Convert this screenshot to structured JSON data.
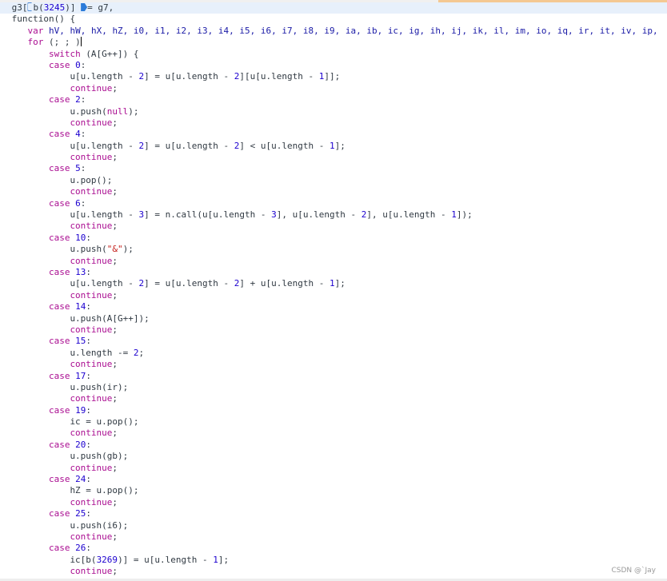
{
  "colors": {
    "keyword": "#aa0d91",
    "number": "#1c00cf",
    "string": "#c41a16",
    "variable": "#1a1aa6",
    "text": "#303942",
    "highlight": "#e7f0fb"
  },
  "icons": [
    "breakpoint-outline-icon",
    "breakpoint-filled-icon"
  ],
  "watermark": "CSDN @`Jay",
  "lines": [
    {
      "indent": 1,
      "hl": true,
      "tokens": [
        {
          "t": "g3["
        },
        {
          "icon": "breakpoint-outline-icon"
        },
        {
          "t": "b("
        },
        {
          "t": "3245",
          "c": "num"
        },
        {
          "t": ")] "
        },
        {
          "icon": "breakpoint-filled-icon"
        },
        {
          "t": "= g7,"
        }
      ]
    },
    {
      "indent": 1,
      "tokens": [
        {
          "t": "function() {"
        }
      ]
    },
    {
      "indent": 4,
      "tokens": [
        {
          "t": "var ",
          "c": "kw"
        },
        {
          "t": "hV, hW, hX, hZ, i0, i1, i2, i3, i4, i5, i6, i7, i8, i9, ia, ib, ic, ig, ih, ij, ik, il, im, io, iq, ir, it, iv, ip,",
          "c": "var"
        }
      ]
    },
    {
      "indent": 4,
      "tokens": [
        {
          "t": "for ",
          "c": "kw"
        },
        {
          "t": "(; ; )"
        },
        {
          "caret": true
        }
      ]
    },
    {
      "indent": 8,
      "tokens": [
        {
          "t": "switch ",
          "c": "kw"
        },
        {
          "t": "(A[G++]) {"
        }
      ]
    },
    {
      "indent": 8,
      "tokens": [
        {
          "t": "case ",
          "c": "kw"
        },
        {
          "t": "0",
          "c": "num"
        },
        {
          "t": ":"
        }
      ]
    },
    {
      "indent": 12,
      "tokens": [
        {
          "t": "u[u.length - "
        },
        {
          "t": "2",
          "c": "num"
        },
        {
          "t": "] = u[u.length - "
        },
        {
          "t": "2",
          "c": "num"
        },
        {
          "t": "][u[u.length - "
        },
        {
          "t": "1",
          "c": "num"
        },
        {
          "t": "]];"
        }
      ]
    },
    {
      "indent": 12,
      "tokens": [
        {
          "t": "continue",
          "c": "kw"
        },
        {
          "t": ";"
        }
      ]
    },
    {
      "indent": 8,
      "tokens": [
        {
          "t": "case ",
          "c": "kw"
        },
        {
          "t": "2",
          "c": "num"
        },
        {
          "t": ":"
        }
      ]
    },
    {
      "indent": 12,
      "tokens": [
        {
          "t": "u.push("
        },
        {
          "t": "null",
          "c": "kw"
        },
        {
          "t": ");"
        }
      ]
    },
    {
      "indent": 12,
      "tokens": [
        {
          "t": "continue",
          "c": "kw"
        },
        {
          "t": ";"
        }
      ]
    },
    {
      "indent": 8,
      "tokens": [
        {
          "t": "case ",
          "c": "kw"
        },
        {
          "t": "4",
          "c": "num"
        },
        {
          "t": ":"
        }
      ]
    },
    {
      "indent": 12,
      "tokens": [
        {
          "t": "u[u.length - "
        },
        {
          "t": "2",
          "c": "num"
        },
        {
          "t": "] = u[u.length - "
        },
        {
          "t": "2",
          "c": "num"
        },
        {
          "t": "] < u[u.length - "
        },
        {
          "t": "1",
          "c": "num"
        },
        {
          "t": "];"
        }
      ]
    },
    {
      "indent": 12,
      "tokens": [
        {
          "t": "continue",
          "c": "kw"
        },
        {
          "t": ";"
        }
      ]
    },
    {
      "indent": 8,
      "tokens": [
        {
          "t": "case ",
          "c": "kw"
        },
        {
          "t": "5",
          "c": "num"
        },
        {
          "t": ":"
        }
      ]
    },
    {
      "indent": 12,
      "tokens": [
        {
          "t": "u.pop();"
        }
      ]
    },
    {
      "indent": 12,
      "tokens": [
        {
          "t": "continue",
          "c": "kw"
        },
        {
          "t": ";"
        }
      ]
    },
    {
      "indent": 8,
      "tokens": [
        {
          "t": "case ",
          "c": "kw"
        },
        {
          "t": "6",
          "c": "num"
        },
        {
          "t": ":"
        }
      ]
    },
    {
      "indent": 12,
      "tokens": [
        {
          "t": "u[u.length - "
        },
        {
          "t": "3",
          "c": "num"
        },
        {
          "t": "] = n.call(u[u.length - "
        },
        {
          "t": "3",
          "c": "num"
        },
        {
          "t": "], u[u.length - "
        },
        {
          "t": "2",
          "c": "num"
        },
        {
          "t": "], u[u.length - "
        },
        {
          "t": "1",
          "c": "num"
        },
        {
          "t": "]);"
        }
      ]
    },
    {
      "indent": 12,
      "tokens": [
        {
          "t": "continue",
          "c": "kw"
        },
        {
          "t": ";"
        }
      ]
    },
    {
      "indent": 8,
      "tokens": [
        {
          "t": "case ",
          "c": "kw"
        },
        {
          "t": "10",
          "c": "num"
        },
        {
          "t": ":"
        }
      ]
    },
    {
      "indent": 12,
      "tokens": [
        {
          "t": "u.push("
        },
        {
          "t": "\"&\"",
          "c": "str"
        },
        {
          "t": ");"
        }
      ]
    },
    {
      "indent": 12,
      "tokens": [
        {
          "t": "continue",
          "c": "kw"
        },
        {
          "t": ";"
        }
      ]
    },
    {
      "indent": 8,
      "tokens": [
        {
          "t": "case ",
          "c": "kw"
        },
        {
          "t": "13",
          "c": "num"
        },
        {
          "t": ":"
        }
      ]
    },
    {
      "indent": 12,
      "tokens": [
        {
          "t": "u[u.length - "
        },
        {
          "t": "2",
          "c": "num"
        },
        {
          "t": "] = u[u.length - "
        },
        {
          "t": "2",
          "c": "num"
        },
        {
          "t": "] + u[u.length - "
        },
        {
          "t": "1",
          "c": "num"
        },
        {
          "t": "];"
        }
      ]
    },
    {
      "indent": 12,
      "tokens": [
        {
          "t": "continue",
          "c": "kw"
        },
        {
          "t": ";"
        }
      ]
    },
    {
      "indent": 8,
      "tokens": [
        {
          "t": "case ",
          "c": "kw"
        },
        {
          "t": "14",
          "c": "num"
        },
        {
          "t": ":"
        }
      ]
    },
    {
      "indent": 12,
      "tokens": [
        {
          "t": "u.push(A[G++]);"
        }
      ]
    },
    {
      "indent": 12,
      "tokens": [
        {
          "t": "continue",
          "c": "kw"
        },
        {
          "t": ";"
        }
      ]
    },
    {
      "indent": 8,
      "tokens": [
        {
          "t": "case ",
          "c": "kw"
        },
        {
          "t": "15",
          "c": "num"
        },
        {
          "t": ":"
        }
      ]
    },
    {
      "indent": 12,
      "tokens": [
        {
          "t": "u.length -= "
        },
        {
          "t": "2",
          "c": "num"
        },
        {
          "t": ";"
        }
      ]
    },
    {
      "indent": 12,
      "tokens": [
        {
          "t": "continue",
          "c": "kw"
        },
        {
          "t": ";"
        }
      ]
    },
    {
      "indent": 8,
      "tokens": [
        {
          "t": "case ",
          "c": "kw"
        },
        {
          "t": "17",
          "c": "num"
        },
        {
          "t": ":"
        }
      ]
    },
    {
      "indent": 12,
      "tokens": [
        {
          "t": "u.push(ir);"
        }
      ]
    },
    {
      "indent": 12,
      "tokens": [
        {
          "t": "continue",
          "c": "kw"
        },
        {
          "t": ";"
        }
      ]
    },
    {
      "indent": 8,
      "tokens": [
        {
          "t": "case ",
          "c": "kw"
        },
        {
          "t": "19",
          "c": "num"
        },
        {
          "t": ":"
        }
      ]
    },
    {
      "indent": 12,
      "tokens": [
        {
          "t": "ic = u.pop();"
        }
      ]
    },
    {
      "indent": 12,
      "tokens": [
        {
          "t": "continue",
          "c": "kw"
        },
        {
          "t": ";"
        }
      ]
    },
    {
      "indent": 8,
      "tokens": [
        {
          "t": "case ",
          "c": "kw"
        },
        {
          "t": "20",
          "c": "num"
        },
        {
          "t": ":"
        }
      ]
    },
    {
      "indent": 12,
      "tokens": [
        {
          "t": "u.push(gb);"
        }
      ]
    },
    {
      "indent": 12,
      "tokens": [
        {
          "t": "continue",
          "c": "kw"
        },
        {
          "t": ";"
        }
      ]
    },
    {
      "indent": 8,
      "tokens": [
        {
          "t": "case ",
          "c": "kw"
        },
        {
          "t": "24",
          "c": "num"
        },
        {
          "t": ":"
        }
      ]
    },
    {
      "indent": 12,
      "tokens": [
        {
          "t": "hZ = u.pop();"
        }
      ]
    },
    {
      "indent": 12,
      "tokens": [
        {
          "t": "continue",
          "c": "kw"
        },
        {
          "t": ";"
        }
      ]
    },
    {
      "indent": 8,
      "tokens": [
        {
          "t": "case ",
          "c": "kw"
        },
        {
          "t": "25",
          "c": "num"
        },
        {
          "t": ":"
        }
      ]
    },
    {
      "indent": 12,
      "tokens": [
        {
          "t": "u.push(i6);"
        }
      ]
    },
    {
      "indent": 12,
      "tokens": [
        {
          "t": "continue",
          "c": "kw"
        },
        {
          "t": ";"
        }
      ]
    },
    {
      "indent": 8,
      "tokens": [
        {
          "t": "case ",
          "c": "kw"
        },
        {
          "t": "26",
          "c": "num"
        },
        {
          "t": ":"
        }
      ]
    },
    {
      "indent": 12,
      "tokens": [
        {
          "t": "ic[b("
        },
        {
          "t": "3269",
          "c": "num"
        },
        {
          "t": ")] = u[u.length - "
        },
        {
          "t": "1",
          "c": "num"
        },
        {
          "t": "];"
        }
      ]
    },
    {
      "indent": 12,
      "tokens": [
        {
          "t": "continue",
          "c": "kw"
        },
        {
          "t": ";"
        }
      ]
    }
  ]
}
